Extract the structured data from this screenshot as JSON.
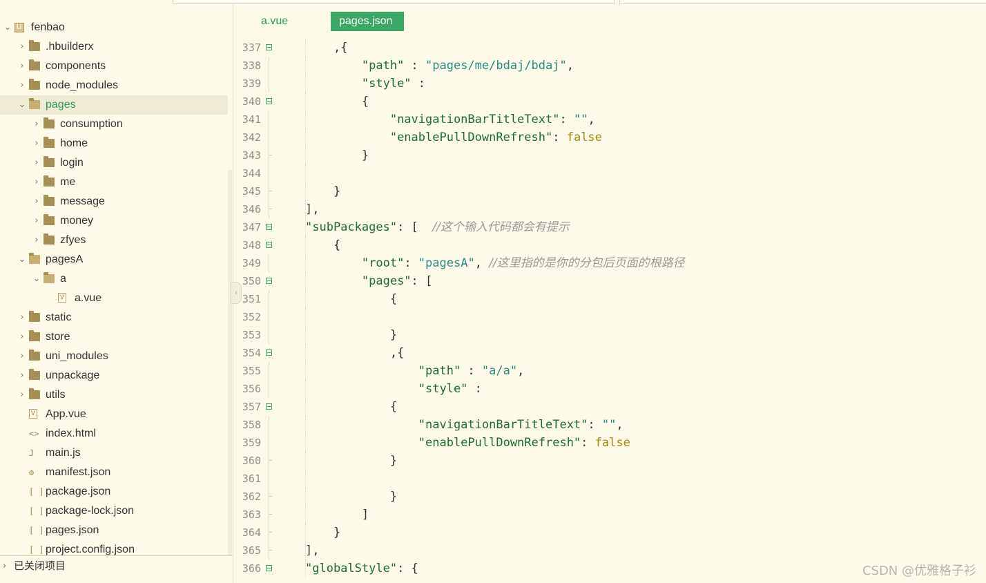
{
  "sidebar": {
    "tree": [
      {
        "label": "fenbao",
        "depth": 0,
        "chev": "⌄",
        "icon": "project-icon",
        "kind": "project"
      },
      {
        "label": ".hbuilderx",
        "depth": 1,
        "chev": "›",
        "icon": "folder-icon",
        "kind": "folder"
      },
      {
        "label": "components",
        "depth": 1,
        "chev": "›",
        "icon": "folder-icon",
        "kind": "folder"
      },
      {
        "label": "node_modules",
        "depth": 1,
        "chev": "›",
        "icon": "folder-icon",
        "kind": "folder"
      },
      {
        "label": "pages",
        "depth": 1,
        "chev": "⌄",
        "icon": "folder-open-icon",
        "kind": "folder-open",
        "selected": true
      },
      {
        "label": "consumption",
        "depth": 2,
        "chev": "›",
        "icon": "folder-icon",
        "kind": "folder"
      },
      {
        "label": "home",
        "depth": 2,
        "chev": "›",
        "icon": "folder-icon",
        "kind": "folder"
      },
      {
        "label": "login",
        "depth": 2,
        "chev": "›",
        "icon": "folder-icon",
        "kind": "folder"
      },
      {
        "label": "me",
        "depth": 2,
        "chev": "›",
        "icon": "folder-icon",
        "kind": "folder"
      },
      {
        "label": "message",
        "depth": 2,
        "chev": "›",
        "icon": "folder-icon",
        "kind": "folder"
      },
      {
        "label": "money",
        "depth": 2,
        "chev": "›",
        "icon": "folder-icon",
        "kind": "folder"
      },
      {
        "label": "zfyes",
        "depth": 2,
        "chev": "›",
        "icon": "folder-icon",
        "kind": "folder"
      },
      {
        "label": "pagesA",
        "depth": 1,
        "chev": "⌄",
        "icon": "folder-open-icon",
        "kind": "folder-open"
      },
      {
        "label": "a",
        "depth": 2,
        "chev": "⌄",
        "icon": "folder-open-icon",
        "kind": "folder-open"
      },
      {
        "label": "a.vue",
        "depth": 3,
        "chev": "",
        "icon": "vue-file-icon",
        "kind": "vue"
      },
      {
        "label": "static",
        "depth": 1,
        "chev": "›",
        "icon": "folder-icon",
        "kind": "folder"
      },
      {
        "label": "store",
        "depth": 1,
        "chev": "›",
        "icon": "folder-icon",
        "kind": "folder"
      },
      {
        "label": "uni_modules",
        "depth": 1,
        "chev": "›",
        "icon": "folder-icon",
        "kind": "folder"
      },
      {
        "label": "unpackage",
        "depth": 1,
        "chev": "›",
        "icon": "folder-icon",
        "kind": "folder"
      },
      {
        "label": "utils",
        "depth": 1,
        "chev": "›",
        "icon": "folder-icon",
        "kind": "folder"
      },
      {
        "label": "App.vue",
        "depth": 1,
        "chev": "",
        "icon": "vue-file-icon",
        "kind": "vue"
      },
      {
        "label": "index.html",
        "depth": 1,
        "chev": "",
        "icon": "html-file-icon",
        "kind": "html",
        "glyph": "<>"
      },
      {
        "label": "main.js",
        "depth": 1,
        "chev": "",
        "icon": "js-file-icon",
        "kind": "js",
        "glyph": "J"
      },
      {
        "label": "manifest.json",
        "depth": 1,
        "chev": "",
        "icon": "settings-file-icon",
        "kind": "manifest",
        "glyph": "⚙"
      },
      {
        "label": "package.json",
        "depth": 1,
        "chev": "",
        "icon": "json-file-icon",
        "kind": "json",
        "glyph": "[ ]"
      },
      {
        "label": "package-lock.json",
        "depth": 1,
        "chev": "",
        "icon": "json-file-icon",
        "kind": "json",
        "glyph": "[ ]"
      },
      {
        "label": "pages.json",
        "depth": 1,
        "chev": "",
        "icon": "json-file-icon",
        "kind": "json",
        "glyph": "[ ]"
      },
      {
        "label": "project.config.json",
        "depth": 1,
        "chev": "",
        "icon": "json-file-icon",
        "kind": "json",
        "glyph": "[ ]"
      }
    ],
    "closed_projects_label": "已关闭项目"
  },
  "tabs": [
    {
      "label": "a.vue",
      "active": false
    },
    {
      "label": "pages.json",
      "active": true
    }
  ],
  "code_lines": [
    {
      "n": "337",
      "fold": "open",
      "indent": "    ",
      "tokens": [
        [
          "p",
          ",{"
        ]
      ]
    },
    {
      "n": "338",
      "indent": "        ",
      "tokens": [
        [
          "k",
          "\"path\""
        ],
        [
          "p",
          " : "
        ],
        [
          "s",
          "\"pages/me/bdaj/bdaj\""
        ],
        [
          "p",
          ","
        ]
      ]
    },
    {
      "n": "339",
      "indent": "        ",
      "tokens": [
        [
          "k",
          "\"style\""
        ],
        [
          "p",
          " :"
        ]
      ]
    },
    {
      "n": "340",
      "fold": "open",
      "indent": "        ",
      "tokens": [
        [
          "p",
          "{"
        ]
      ]
    },
    {
      "n": "341",
      "indent": "            ",
      "tokens": [
        [
          "k",
          "\"navigationBarTitleText\""
        ],
        [
          "p",
          ": "
        ],
        [
          "s",
          "\"\""
        ],
        [
          "p",
          ","
        ]
      ]
    },
    {
      "n": "342",
      "indent": "            ",
      "tokens": [
        [
          "k",
          "\"enablePullDownRefresh\""
        ],
        [
          "p",
          ": "
        ],
        [
          "w",
          "false"
        ]
      ]
    },
    {
      "n": "343",
      "fold": "end",
      "indent": "        ",
      "tokens": [
        [
          "p",
          "}"
        ]
      ]
    },
    {
      "n": "344",
      "indent": "",
      "tokens": []
    },
    {
      "n": "345",
      "fold": "end",
      "indent": "    ",
      "tokens": [
        [
          "p",
          "}"
        ]
      ]
    },
    {
      "n": "346",
      "fold": "end",
      "indent": "",
      "tokens": [
        [
          "p",
          "],"
        ]
      ]
    },
    {
      "n": "347",
      "fold": "open",
      "indent": "",
      "tokens": [
        [
          "k",
          "\"subPackages\""
        ],
        [
          "p",
          ": [  "
        ],
        [
          "c",
          "//这个输入代码都会有提示"
        ]
      ]
    },
    {
      "n": "348",
      "fold": "open",
      "indent": "    ",
      "tokens": [
        [
          "p",
          "{"
        ]
      ]
    },
    {
      "n": "349",
      "indent": "        ",
      "tokens": [
        [
          "k",
          "\"root\""
        ],
        [
          "p",
          ": "
        ],
        [
          "s",
          "\"pagesA\""
        ],
        [
          "p",
          ", "
        ],
        [
          "c",
          "//这里指的是你的分包后页面的根路径"
        ]
      ]
    },
    {
      "n": "350",
      "fold": "open",
      "indent": "        ",
      "tokens": [
        [
          "k",
          "\"pages\""
        ],
        [
          "p",
          ": ["
        ]
      ]
    },
    {
      "n": "351",
      "indent": "            ",
      "tokens": [
        [
          "p",
          "{"
        ]
      ]
    },
    {
      "n": "352",
      "indent": "",
      "tokens": []
    },
    {
      "n": "353",
      "indent": "            ",
      "tokens": [
        [
          "p",
          "}"
        ]
      ]
    },
    {
      "n": "354",
      "fold": "open",
      "indent": "            ",
      "tokens": [
        [
          "p",
          ",{"
        ]
      ]
    },
    {
      "n": "355",
      "indent": "                ",
      "tokens": [
        [
          "k",
          "\"path\""
        ],
        [
          "p",
          " : "
        ],
        [
          "s",
          "\"a/a\""
        ],
        [
          "p",
          ","
        ]
      ]
    },
    {
      "n": "356",
      "indent": "                ",
      "tokens": [
        [
          "k",
          "\"style\""
        ],
        [
          "p",
          " :"
        ]
      ]
    },
    {
      "n": "357",
      "fold": "open",
      "indent": "            ",
      "tokens": [
        [
          "p",
          "{"
        ]
      ]
    },
    {
      "n": "358",
      "indent": "                ",
      "tokens": [
        [
          "k",
          "\"navigationBarTitleText\""
        ],
        [
          "p",
          ": "
        ],
        [
          "s",
          "\"\""
        ],
        [
          "p",
          ","
        ]
      ]
    },
    {
      "n": "359",
      "indent": "                ",
      "tokens": [
        [
          "k",
          "\"enablePullDownRefresh\""
        ],
        [
          "p",
          ": "
        ],
        [
          "w",
          "false"
        ]
      ]
    },
    {
      "n": "360",
      "fold": "end",
      "indent": "            ",
      "tokens": [
        [
          "p",
          "}"
        ]
      ]
    },
    {
      "n": "361",
      "indent": "",
      "tokens": []
    },
    {
      "n": "362",
      "fold": "end",
      "indent": "            ",
      "tokens": [
        [
          "p",
          "}"
        ]
      ]
    },
    {
      "n": "363",
      "fold": "end",
      "indent": "        ",
      "tokens": [
        [
          "p",
          "]"
        ]
      ]
    },
    {
      "n": "364",
      "fold": "end",
      "indent": "    ",
      "tokens": [
        [
          "p",
          "}"
        ]
      ]
    },
    {
      "n": "365",
      "fold": "end",
      "indent": "",
      "tokens": [
        [
          "p",
          "],"
        ]
      ]
    },
    {
      "n": "366",
      "fold": "open",
      "indent": "",
      "tokens": [
        [
          "k",
          "\"globalStyle\""
        ],
        [
          "p",
          ": {"
        ]
      ]
    }
  ],
  "watermark": "CSDN @优雅格子衫",
  "colors": {
    "accent": "#3aa864",
    "background": "#fefae9",
    "key": "#1e6b30",
    "string": "#2b8a8a",
    "keyword": "#a8860e",
    "comment": "#999999"
  }
}
